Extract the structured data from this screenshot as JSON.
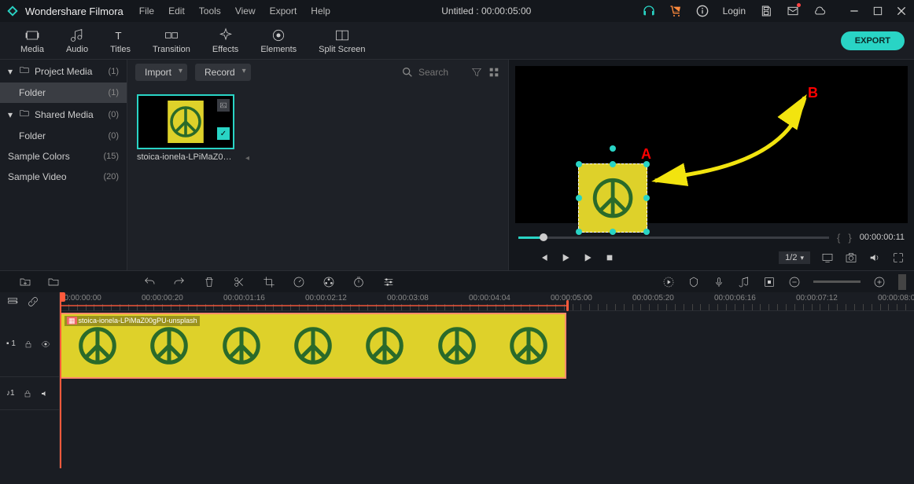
{
  "app": {
    "name": "Wondershare Filmora",
    "doc_title": "Untitled : 00:00:05:00"
  },
  "menu": [
    "File",
    "Edit",
    "Tools",
    "View",
    "Export",
    "Help"
  ],
  "header_right": {
    "login": "Login"
  },
  "tabs": [
    {
      "label": "Media"
    },
    {
      "label": "Audio"
    },
    {
      "label": "Titles"
    },
    {
      "label": "Transition"
    },
    {
      "label": "Effects"
    },
    {
      "label": "Elements"
    },
    {
      "label": "Split Screen"
    }
  ],
  "export_btn": "EXPORT",
  "sidebar": {
    "items": [
      {
        "label": "Project Media",
        "count": "(1)",
        "indent": false,
        "arrow": true,
        "folder": true
      },
      {
        "label": "Folder",
        "count": "(1)",
        "indent": true,
        "active": true
      },
      {
        "label": "Shared Media",
        "count": "(0)",
        "indent": false,
        "arrow": true,
        "folder": true
      },
      {
        "label": "Folder",
        "count": "(0)",
        "indent": true
      },
      {
        "label": "Sample Colors",
        "count": "(15)",
        "indent": false
      },
      {
        "label": "Sample Video",
        "count": "(20)",
        "indent": false
      }
    ]
  },
  "media_toolbar": {
    "import": "Import",
    "record": "Record",
    "search_placeholder": "Search"
  },
  "media_item": {
    "name": "stoica-ionela-LPiMaZ00g..."
  },
  "preview": {
    "ann_a": "A",
    "ann_b": "B",
    "scrub_time": "00:00:00:11",
    "ratio": "1/2"
  },
  "ruler": [
    "00:00:00:00",
    "00:00:00:20",
    "00:00:01:16",
    "00:00:02:12",
    "00:00:03:08",
    "00:00:04:04",
    "00:00:05:00",
    "00:00:05:20",
    "00:00:06:16",
    "00:00:07:12",
    "00:00:08:0"
  ],
  "clip": {
    "label": "stoica-ionela-LPiMaZ00gPU-unsplash"
  },
  "track1": {
    "name": "1"
  },
  "track_audio": {
    "name": "♪1"
  }
}
